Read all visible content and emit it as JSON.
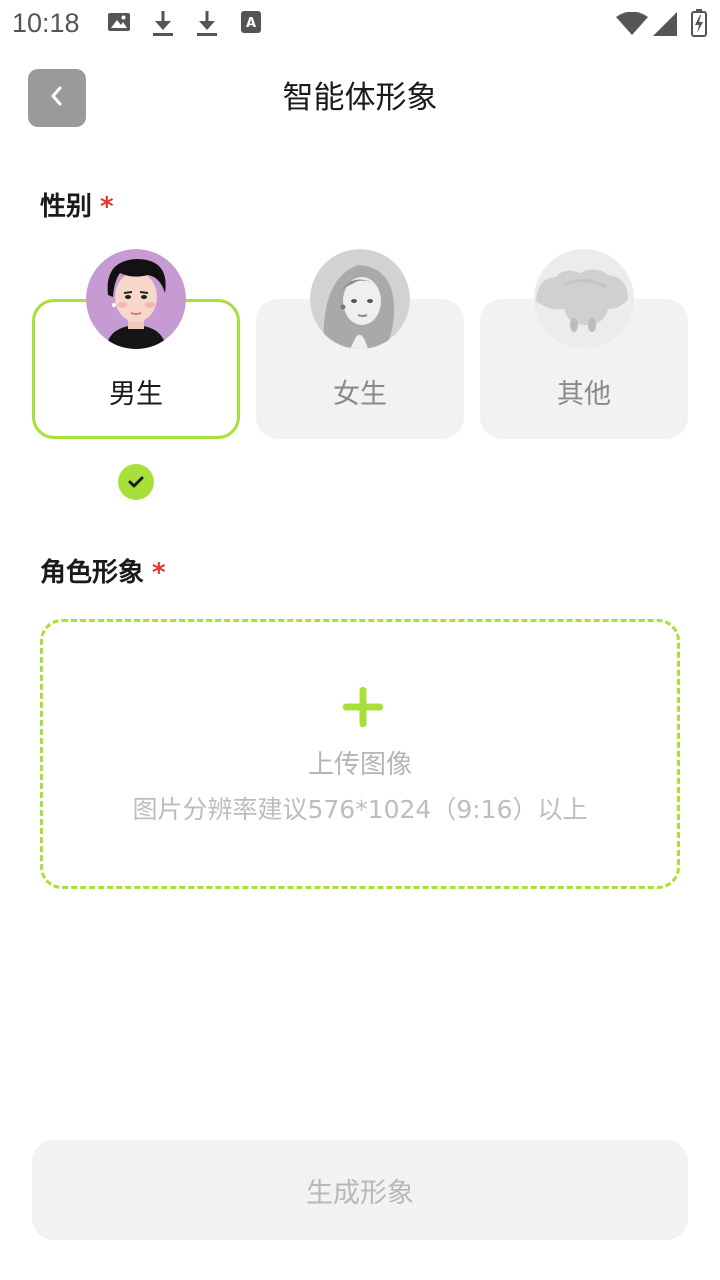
{
  "status_bar": {
    "time": "10:18",
    "icons_left": [
      "image-icon",
      "download-icon",
      "download-icon",
      "font-icon"
    ],
    "icons_right": [
      "wifi-icon",
      "cell-signal-icon",
      "battery-charging-icon"
    ]
  },
  "header": {
    "title": "智能体形象",
    "back_icon": "chevron-left-icon"
  },
  "gender_section": {
    "label": "性别",
    "required_mark": "*",
    "options": [
      {
        "label": "男生",
        "selected": true
      },
      {
        "label": "女生",
        "selected": false
      },
      {
        "label": "其他",
        "selected": false
      }
    ]
  },
  "character_section": {
    "label": "角色形象",
    "required_mark": "*",
    "upload_label": "上传图像",
    "upload_hint": "图片分辨率建议576*1024（9:16）以上"
  },
  "generate_button": {
    "label": "生成形象"
  },
  "colors": {
    "accent": "#a8e03a",
    "required": "#e5352c",
    "back_button": "#9a9a9a",
    "card_bg": "#f2f2f2"
  }
}
